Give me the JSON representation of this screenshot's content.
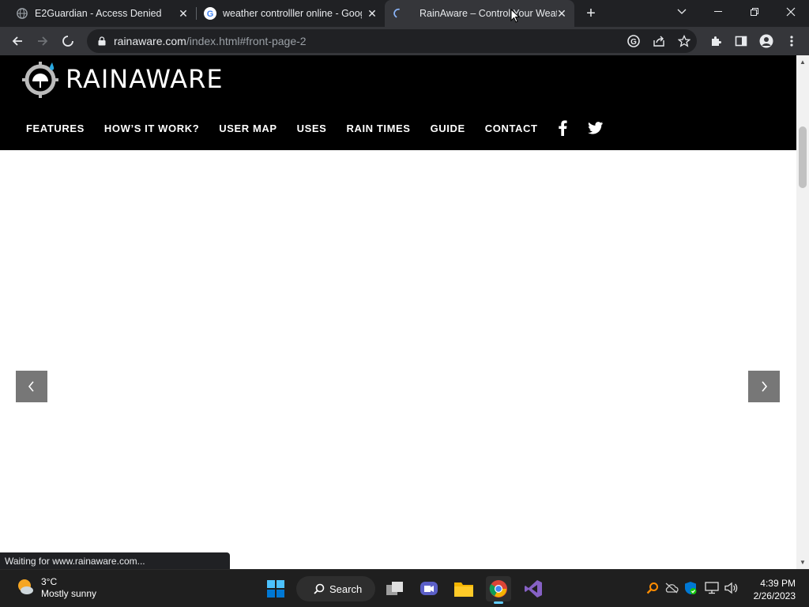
{
  "browser": {
    "tabs": [
      {
        "title": "E2Guardian - Access Denied",
        "favicon": "globe-icon"
      },
      {
        "title": "weather controlller online - Goog",
        "favicon": "google-icon"
      },
      {
        "title": "RainAware – Control Your Weathe",
        "favicon": "loading-spinner-icon"
      }
    ],
    "url_host": "rainaware.com",
    "url_path": "/index.html#front-page-2",
    "status_text": "Waiting for www.rainaware.com..."
  },
  "site": {
    "brand": "RAINAWARE",
    "nav": [
      "FEATURES",
      "HOW’S IT WORK?",
      "USER MAP",
      "USES",
      "RAIN TIMES",
      "GUIDE",
      "CONTACT"
    ]
  },
  "taskbar": {
    "weather_temp": "3°C",
    "weather_desc": "Mostly sunny",
    "search_label": "Search",
    "time": "4:39 PM",
    "date": "2/26/2023"
  },
  "colors": {
    "chrome_dark": "#202124",
    "chrome_toolbar": "#35363a",
    "site_header": "#000000",
    "slider_arrow": "#777777"
  }
}
